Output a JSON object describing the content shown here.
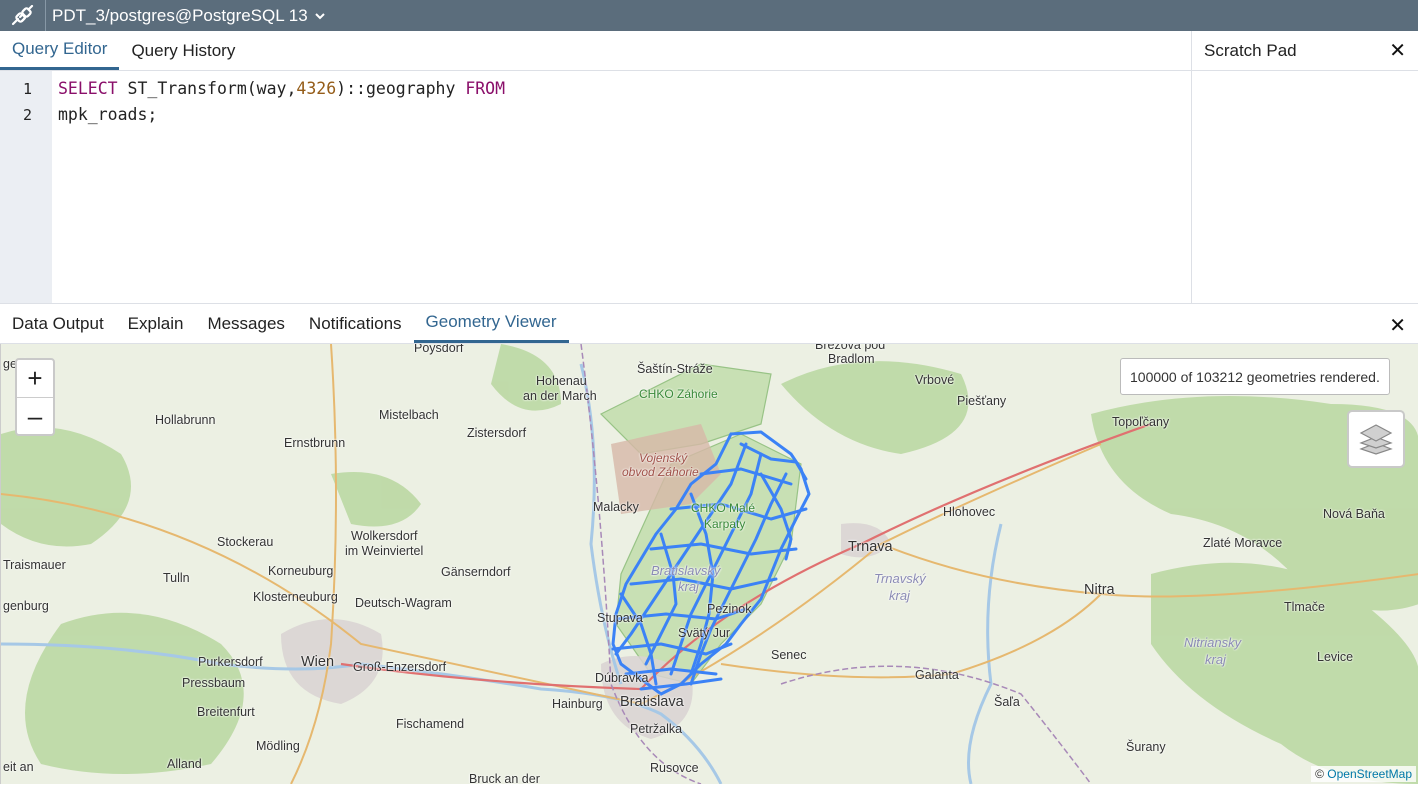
{
  "connection": {
    "title": "PDT_3/postgres@PostgreSQL 13"
  },
  "editor": {
    "tabs": [
      {
        "label": "Query Editor"
      },
      {
        "label": "Query History"
      }
    ],
    "line_numbers": [
      "1",
      "2"
    ],
    "code": {
      "line1_kw1": "SELECT",
      "line1_fn": " ST_Transform(way,",
      "line1_num": "4326",
      "line1_cast": ")::geography ",
      "line1_kw2": "FROM",
      "line2": "mpk_roads;"
    }
  },
  "scratch_pad": {
    "title": "Scratch Pad"
  },
  "results": {
    "tabs": [
      {
        "label": "Data Output"
      },
      {
        "label": "Explain"
      },
      {
        "label": "Messages"
      },
      {
        "label": "Notifications"
      },
      {
        "label": "Geometry Viewer"
      }
    ]
  },
  "map": {
    "zoom_in": "+",
    "zoom_out": "–",
    "render_info": "100000 of 103212 geometries rendered.",
    "attribution_prefix": "© ",
    "attribution_link": "OpenStreetMap",
    "labels": {
      "poysdorf": "Poysdorf",
      "brezova": "Brezová pod",
      "bradlom": "Bradlom",
      "sastin": "Šaštín-Stráže",
      "genburg": "genburg",
      "hohenau1": "Hohenau",
      "hohenau2": "an der March",
      "chko_zahorie": "CHKO Záhorie",
      "vrbove": "Vrbové",
      "piestany": "Piešťany",
      "mistelbach": "Mistelbach",
      "hollabrunn": "Hollabrunn",
      "zistersdorf": "Zistersdorf",
      "topolcany": "Topoľčany",
      "ernstbrunn": "Ernstbrunn",
      "vojensky1": "Vojenský",
      "vojensky2": "obvod Záhorie",
      "malacky": "Malacky",
      "chko_male1": "CHKO Malé",
      "chko_male2": "Karpaty",
      "hlohovec": "Hlohovec",
      "nova_bana": "Nová Baňa",
      "stockerau": "Stockerau",
      "wolkersdorf1": "Wolkersdorf",
      "wolkersdorf2": "im Weinviertel",
      "trnava": "Trnava",
      "zlate_moravce": "Zlaté Moravce",
      "traismauer": "Traismauer",
      "bratislavsky1": "Bratislavský",
      "bratislavsky2": "kraj",
      "tulln": "Tulln",
      "korneuburg": "Korneuburg",
      "ganserndorf": "Gänserndorf",
      "trnavsky1": "Trnavský",
      "trnavsky2": "kraj",
      "nitra": "Nitra",
      "klosterneuburg": "Klosterneuburg",
      "deutsch_wagram": "Deutsch-Wagram",
      "genburg2": "genburg",
      "tlmace": "Tlmače",
      "stupava": "Stupava",
      "pezinok": "Pezinok",
      "svaty_jur": "Svätý Jur",
      "nitriansky1": "Nitriansky",
      "nitriansky2": "kraj",
      "purkersdorf": "Purkersdorf",
      "wien": "Wien",
      "gross_enzersdorf": "Groß-Enzersdorf",
      "senec": "Senec",
      "levice": "Levice",
      "pressbaum": "Pressbaum",
      "galanta": "Galanta",
      "dubravka": "Dúbravka",
      "hainburg": "Hainburg",
      "bratislava": "Bratislava",
      "sala": "Šaľa",
      "breitenfurt": "Breitenfurt",
      "fischamend": "Fischamend",
      "petrzalka": "Petržalka",
      "modling": "Mödling",
      "surany": "Šurany",
      "alland": "Alland",
      "rusovce": "Rusovce",
      "bruck": "Bruck an der",
      "eit_an": "eit an"
    }
  },
  "colors": {
    "header_bg": "#5b6d7c",
    "accent": "#326690",
    "keyword": "#8a0f6a",
    "number": "#945c18",
    "geometry": "#3b82f6"
  }
}
